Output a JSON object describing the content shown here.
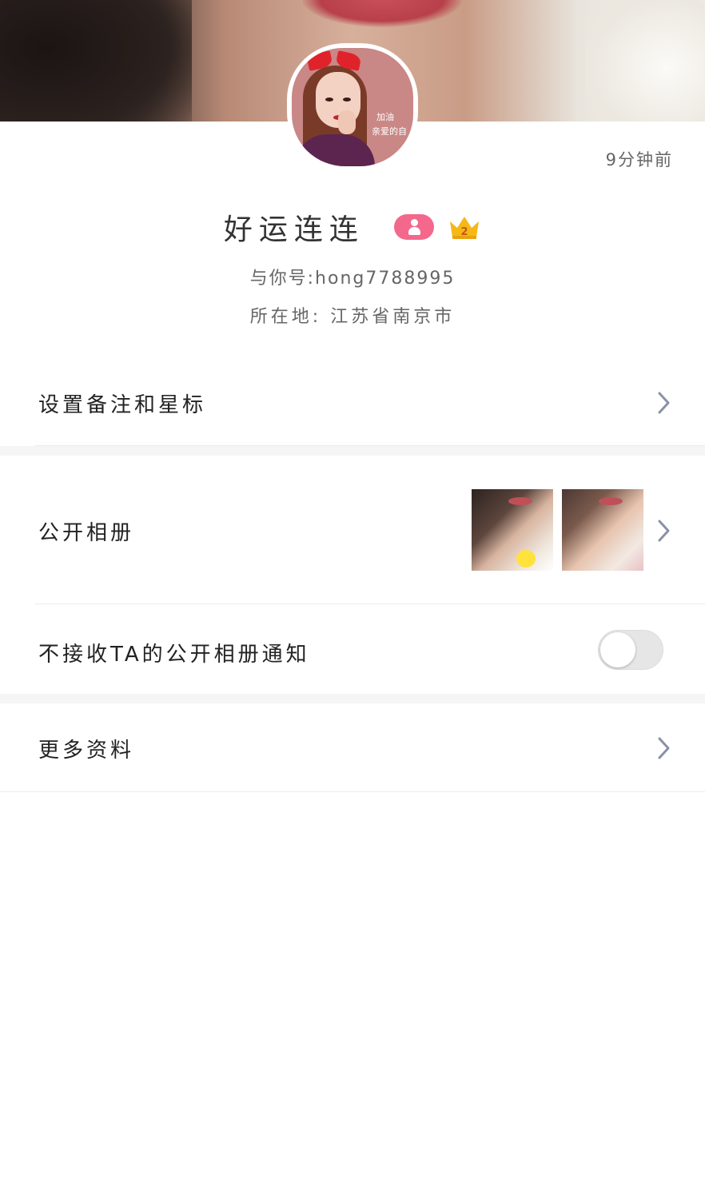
{
  "profile": {
    "last_active": "9分钟前",
    "name": "好运连连",
    "vip_level": "2",
    "id_line": "与你号:hong7788995",
    "location_line": "所在地: 江苏省南京市",
    "avatar_text_1": "加油",
    "avatar_text_2": "亲爱的自"
  },
  "menu": {
    "remark_label": "设置备注和星标",
    "album_label": "公开相册",
    "notify_label": "不接收TA的公开相册通知",
    "notify_enabled": false,
    "more_label": "更多资料"
  },
  "colors": {
    "gender_badge": "#f3688c",
    "crown": "#f5b818",
    "chevron": "#8a90a8",
    "toggle_off": "#e6e6e6"
  }
}
